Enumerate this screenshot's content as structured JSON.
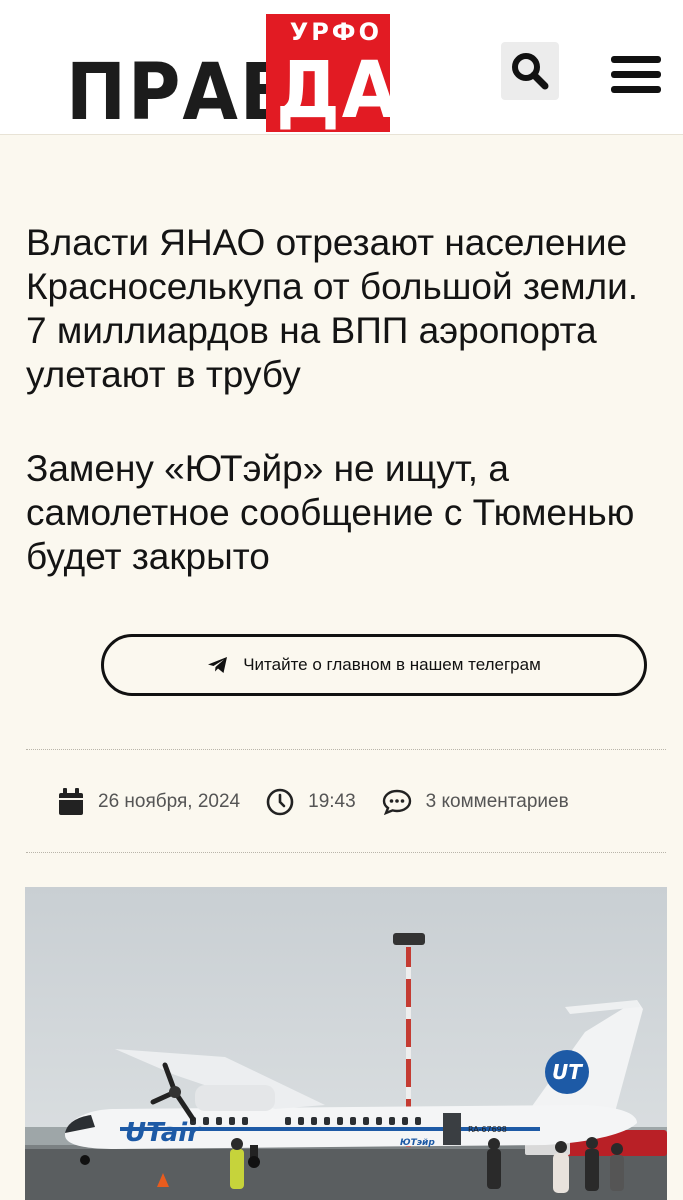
{
  "header": {
    "logo_main": "ПРАВ",
    "logo_red_top": "УРФО",
    "logo_red_bottom": "ДА",
    "search_icon": "search-icon",
    "menu_icon": "hamburger-menu-icon"
  },
  "article": {
    "title": "Власти ЯНАО отрезают население Красноселькупа от большой земли. 7 миллиардов на ВПП аэропорта улетают в трубу",
    "subtitle": "Замену «ЮТэйр» не ищут, а самолетное сообщение с Тюменью будет закрыто",
    "telegram_button": "Читайте о главном в нашем телеграм",
    "meta": {
      "date": "26 ноября, 2024",
      "time": "19:43",
      "comments": "3 комментариев"
    },
    "photo": {
      "registration": "RA-67698",
      "tail_logo": "UT",
      "fuselage_text": "ЮТэйр"
    }
  },
  "colors": {
    "brand_red": "#e21b23",
    "page_bg": "#fbf8ef",
    "text": "#141414",
    "meta_text": "#555555"
  }
}
